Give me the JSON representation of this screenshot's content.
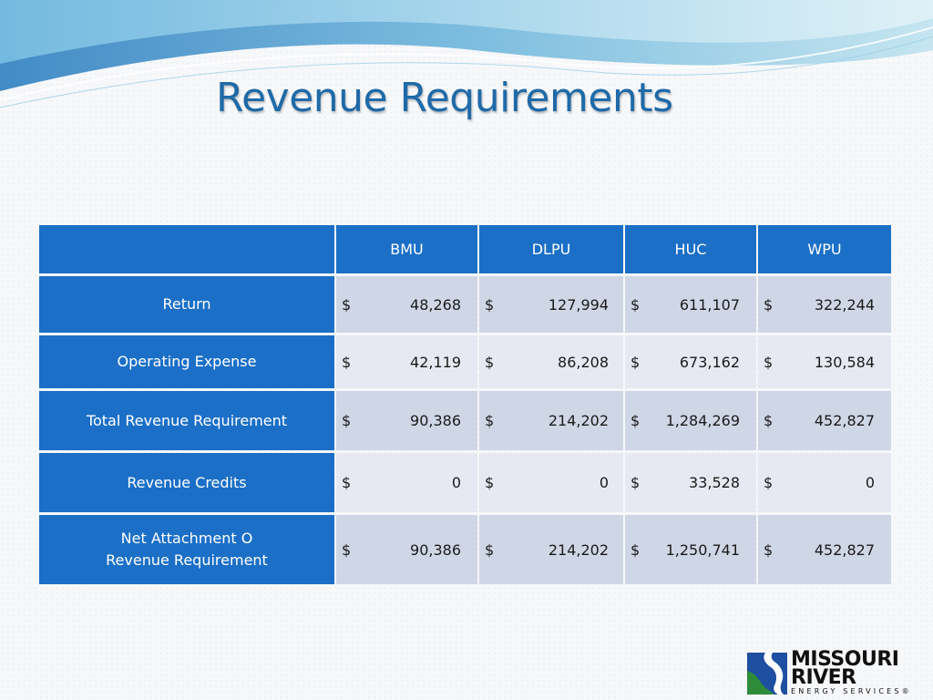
{
  "slide": {
    "title": "Revenue Requirements"
  },
  "table": {
    "columns": [
      "",
      "BMU",
      "DLPU",
      "HUC",
      "WPU"
    ],
    "rows": [
      {
        "label": [
          "Return"
        ],
        "values": [
          [
            "$",
            "48,268"
          ],
          [
            "$",
            "127,994"
          ],
          [
            "$",
            "611,107"
          ],
          [
            "$",
            "322,244"
          ]
        ]
      },
      {
        "label": [
          "Operating Expense"
        ],
        "values": [
          [
            "$",
            "42,119"
          ],
          [
            "$",
            "86,208"
          ],
          [
            "$",
            "673,162"
          ],
          [
            "$",
            "130,584"
          ]
        ]
      },
      {
        "label": [
          "Total Revenue Requirement"
        ],
        "values": [
          [
            "$",
            "90,386"
          ],
          [
            "$",
            "214,202"
          ],
          [
            "$",
            "1,284,269"
          ],
          [
            "$",
            "452,827"
          ]
        ]
      },
      {
        "label": [
          "Revenue Credits"
        ],
        "values": [
          [
            "$",
            "0"
          ],
          [
            "$",
            "0"
          ],
          [
            "$",
            "33,528"
          ],
          [
            "$",
            "0"
          ]
        ]
      },
      {
        "label": [
          "Net Attachment O",
          "Revenue Requirement"
        ],
        "values": [
          [
            "$",
            "90,386"
          ],
          [
            "$",
            "214,202"
          ],
          [
            "$",
            "1,250,741"
          ],
          [
            "$",
            "452,827"
          ]
        ]
      }
    ]
  },
  "logo": {
    "line1": "MISSOURI",
    "line2": "RIVER",
    "line3": "ENERGY SERVICES®"
  },
  "colors": {
    "title": "#1f6aa8",
    "header_fill": "#1b6fc7",
    "row_odd": "#cfd6e6",
    "row_even": "#e6e9f2",
    "logo_green": "#2e8b3a",
    "logo_blue": "#1f4fa0"
  }
}
